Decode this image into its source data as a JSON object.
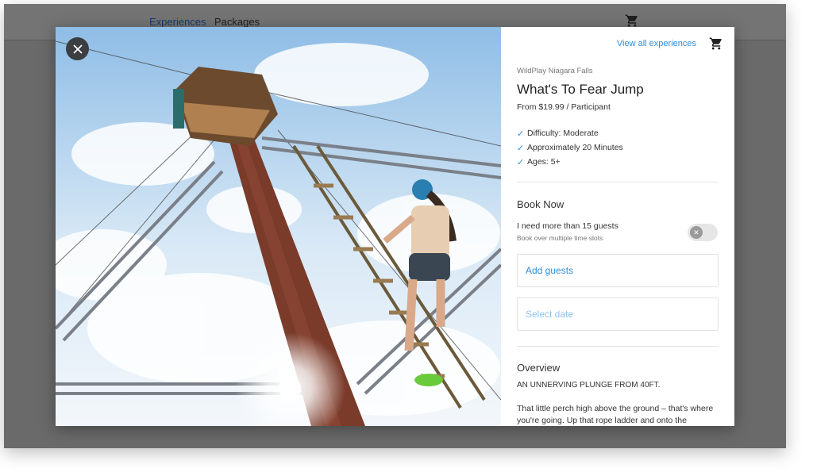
{
  "background_nav": {
    "links": [
      {
        "label": "Experiences",
        "active": true
      },
      {
        "label": "Packages",
        "active": false
      }
    ],
    "cart_icon": "shopping-cart-icon"
  },
  "modal": {
    "close_icon": "close-icon",
    "photo_alt_icon": "photo-ropes-course",
    "panel": {
      "view_all_label": "View all experiences",
      "cart_icon": "shopping-cart-icon",
      "venue": "WildPlay Niagara Falls",
      "title": "What's To Fear Jump",
      "price": "From $19.99 / Participant",
      "features": [
        "Difficulty: Moderate",
        "Approximately 20 Minutes",
        "Ages: 5+"
      ],
      "book_now": "Book Now",
      "large_group_label": "I need more than 15 guests",
      "large_group_sub": "Book over multiple time slots",
      "large_group_toggle_on": false,
      "guests_placeholder": "Add guests",
      "date_placeholder": "Select date",
      "overview_heading": "Overview",
      "overview_subheading": "AN UNNERVING PLUNGE FROM 40FT.",
      "overview_body": "That little perch high above the ground – that's where you're going. Up that rope ladder and onto the"
    }
  },
  "colors": {
    "accent": "#2b8fde",
    "overlay": "#6a6a6a",
    "close_button": "#3b3d40"
  }
}
